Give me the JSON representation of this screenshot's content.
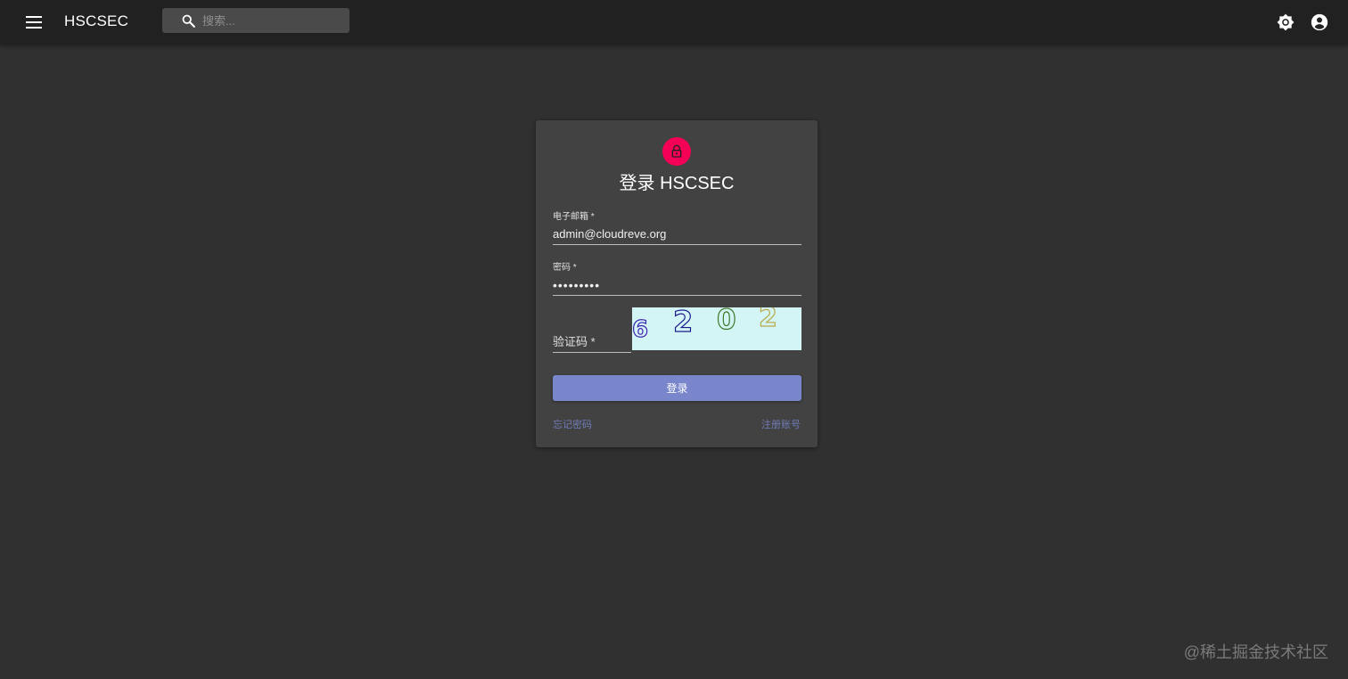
{
  "app": {
    "title": "HSCSEC"
  },
  "topbar": {
    "search_placeholder": "搜索...",
    "menu_icon": "menu-icon",
    "theme_icon": "brightness-icon",
    "account_icon": "account-circle-icon"
  },
  "login": {
    "icon": "lock-icon",
    "icon_color": "#f50057",
    "title": "登录 HSCSEC",
    "email_label": "电子邮箱 *",
    "email_value": "admin@cloudreve.org",
    "password_label": "密码 *",
    "password_value": "•••••••••",
    "captcha_placeholder": "验证码 *",
    "captcha_chars": [
      "6",
      "2",
      "0",
      "2"
    ],
    "submit_label": "登录",
    "submit_color": "#7986cb",
    "forgot_password": "忘记密码",
    "register": "注册账号"
  },
  "watermark": "@稀土掘金技术社区"
}
